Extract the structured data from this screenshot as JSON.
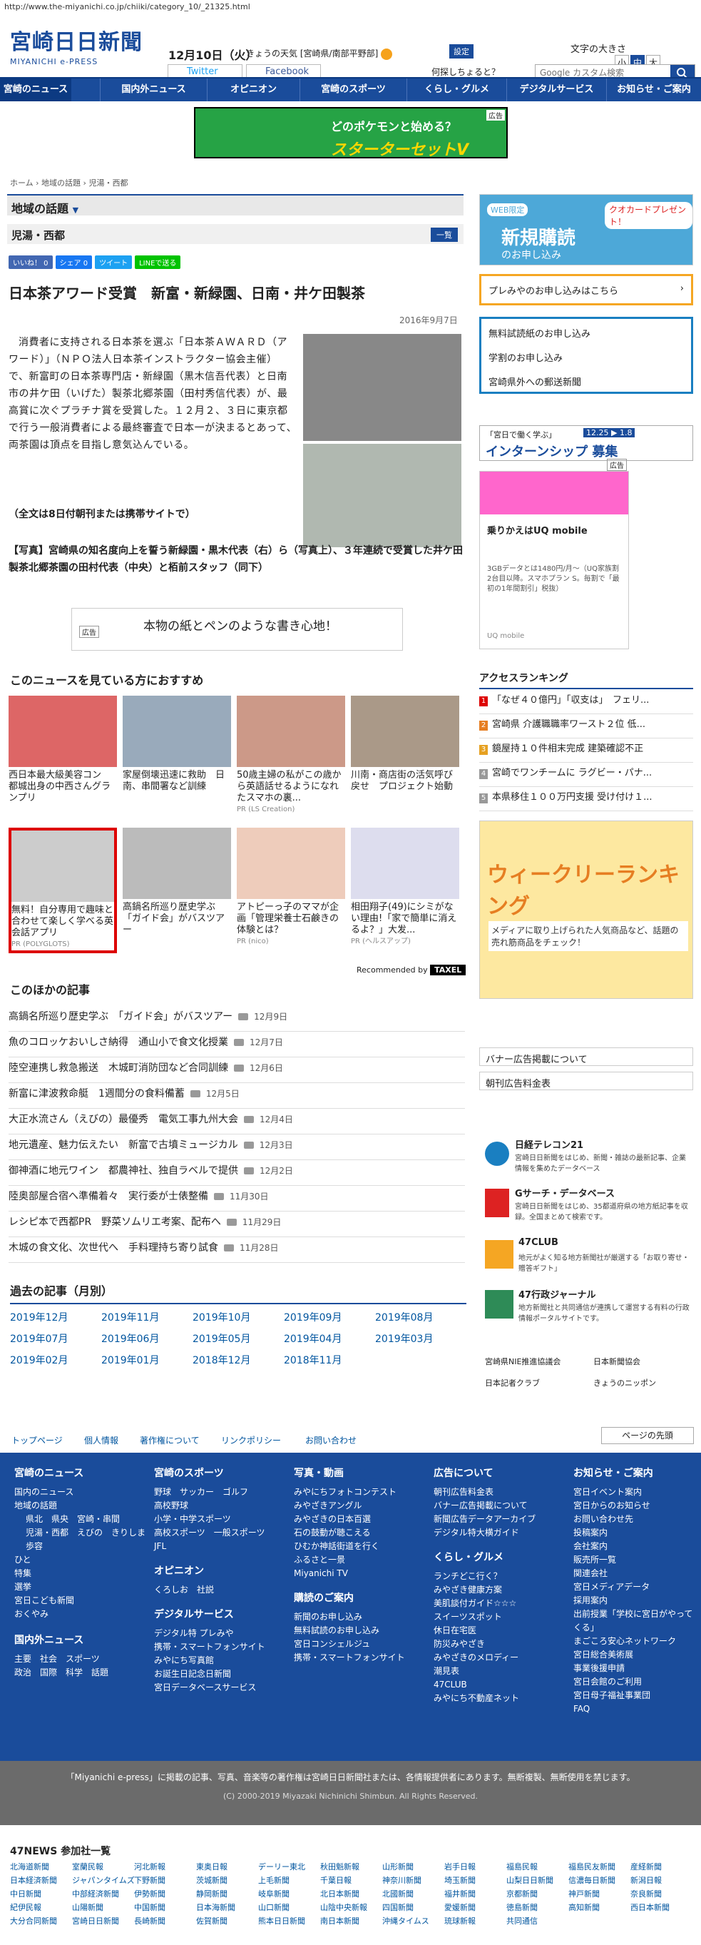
{
  "browser": {
    "url": "http://www.the-miyanichi.co.jp/chiiki/category_10/_21325.html"
  },
  "header": {
    "logo_main": "宮崎日日新聞",
    "logo_sub": "MIYANICHI e-PRESS",
    "date": "12月10日（火）",
    "weather_label": "きょうの天気",
    "region": "[宮崎県/南部平野部]",
    "settings": "設定",
    "font_size_label": "文字の大きさ",
    "font_sizes": [
      "小",
      "中",
      "大"
    ],
    "twitter": "Twitter",
    "facebook": "Facebook",
    "query": "何探しちょると？",
    "search_placeholder": "Google カスタム検索"
  },
  "nav": [
    "宮崎のニュース",
    "国内外ニュース",
    "オピニオン",
    "宮崎のスポーツ",
    "くらし・グルメ",
    "デジタルサービス",
    "お知らせ・ご案内"
  ],
  "banner": {
    "line1": "どのポケモンと始める？",
    "line2": "スターターセットV",
    "badge": "広告"
  },
  "breadcrumb": "ホーム › 地域の話題 › 児湯・西都",
  "section": {
    "title": "地域の話題",
    "sub": "児湯・西都",
    "list_btn": "一覧"
  },
  "share": {
    "like": "いいね！ 0",
    "fb_share": "シェア 0",
    "tweet": "ツイート",
    "line": "LINEで送る"
  },
  "article": {
    "title": "日本茶アワード受賞　新富・新緑園、日南・井ケ田製茶",
    "date": "2016年9月7日",
    "body": "消費者に支持される日本茶を選ぶ「日本茶ＡＷＡＲＤ（アワード）」（ＮＰＯ法人日本茶インストラクター協会主催）で、新富町の日本茶専門店・新緑園（黒木信吾代表）と日南市の井ケ田（いげた）製茶北郷茶園（田村秀信代表）が、最高賞に次ぐプラチナ賞を受賞した。１２月２、３日に東京都で行う一般消費者による最終審査で日本一が決まるとあって、両茶園は頂点を目指し意気込んでいる。",
    "full_text": "（全文は8日付朝刊または携帯サイトで）",
    "caption": "【写真】宮崎県の知名度向上を誓う新緑園・黒木代表（右）ら（写真上）、３年連続で受賞した井ケ田製茶北郷茶園の田村代表（中央）と栢前スタッフ（同下）"
  },
  "inline_ad": {
    "badge": "広告",
    "text": "本物の紙とペンのような書き心地！"
  },
  "recommend": {
    "title": "このニュースを見ている方におすすめ",
    "items": [
      {
        "text": "西日本最大級美容コン　都城出身の中西さんグランプリ",
        "pr": ""
      },
      {
        "text": "家屋倒壊迅速に救助　日南、串間署など訓練",
        "pr": ""
      },
      {
        "text": "50歳主婦の私がこの歳から英語話せるようになれたスマホの裏...",
        "pr": "PR (LS Creation)"
      },
      {
        "text": "川南・商店街の活気呼び戻せ　プロジェクト始動",
        "pr": ""
      },
      {
        "text": "無料！自分専用で趣味と合わせて楽しく学べる英会話アプリ",
        "pr": "PR (POLYGLOTS)"
      },
      {
        "text": "高鍋名所巡り歴史学ぶ　「ガイド会」がバスツアー",
        "pr": ""
      },
      {
        "text": "アトピーっ子のママが企画「管理栄養士石鹸きの体験とは？",
        "pr": "PR (nico)"
      },
      {
        "text": "相田翔子(49)にシミがない理由!「家で簡単に消えるよ？」大发...",
        "pr": "PR (ヘルスアップ)"
      }
    ],
    "recommended_by": "Recommended by",
    "taxel": "TAXEL"
  },
  "other": {
    "title": "このほかの記事",
    "items": [
      {
        "text": "高鍋名所巡り歴史学ぶ　「ガイド会」がバスツアー",
        "date": "12月9日"
      },
      {
        "text": "魚のコロッケおいしさ納得　通山小で食文化授業",
        "date": "12月7日"
      },
      {
        "text": "陸空連携し救急搬送　木城町消防団など合同訓練",
        "date": "12月6日"
      },
      {
        "text": "新富に津波救命艇　1週間分の食料備蓄",
        "date": "12月5日"
      },
      {
        "text": "大正水流さん（えびの）最優秀　電気工事九州大会",
        "date": "12月4日"
      },
      {
        "text": "地元遺産、魅力伝えたい　新富で古墳ミュージカル",
        "date": "12月3日"
      },
      {
        "text": "御神酒に地元ワイン　都農神社、独自ラベルで提供",
        "date": "12月2日"
      },
      {
        "text": "陸奥部屋合宿へ準備着々　実行委が士俵整備",
        "date": "11月30日"
      },
      {
        "text": "レシピ本で西都PR　野菜ソムリエ考案、配布へ",
        "date": "11月29日"
      },
      {
        "text": "木城の食文化、次世代へ　手料理持ち寄り試食",
        "date": "11月28日"
      }
    ]
  },
  "past": {
    "title": "過去の記事（月別）",
    "months": [
      "2019年12月",
      "2019年11月",
      "2019年10月",
      "2019年09月",
      "2019年08月",
      "2019年07月",
      "2019年06月",
      "2019年05月",
      "2019年04月",
      "2019年03月",
      "2019年02月",
      "2019年01月",
      "2018年12月",
      "2018年11月"
    ]
  },
  "sidebar": {
    "subscribe_title": "新規購読",
    "subscribe_sub": "のお申し込み",
    "web_limited": "WEB限定",
    "present": "クオカードプレゼント！",
    "premium": "プレみやのお申し込みはこちら",
    "links": [
      "無料試読紙のお申し込み",
      "学割のお申し込み",
      "宮崎県外への郵送新聞"
    ],
    "internship_lead": "「宮日で働く学ぶ」",
    "internship": "インターンシップ 募集",
    "internship_date": "12.25",
    "internship_date2": "1.8",
    "ad_badge": "広告",
    "ad_title": "乗りかえはUQ mobile",
    "ad_body": "3GBデータとは1480円/月〜（UQ家族割2台目以降。スマホプラン S。毎割で「最初の1年間割引」税抜）",
    "ad_brand": "UQ mobile",
    "ranking_title": "アクセスランキング",
    "ranking": [
      "「なぜ４０億円」「収支は」　フェリ...",
      "宮崎県 介護職職率ワースト２位 低...",
      "鏡屋持１０件相末完成 建築確認不正",
      "宮崎でワンチームに ラグビー・パナ...",
      "本県移住１００万円支援 受け付け１..."
    ],
    "weekly_title": "ウィークリーランキング",
    "weekly_sub": "メディアに取り上げられた人気商品など、話題の売れ筋商品をチェック！",
    "links2": [
      "バナー広告掲載について",
      "朝刊広告料金表"
    ],
    "services": [
      {
        "name": "日経テレコン21",
        "desc": "宮崎日日新聞をはじめ、新聞・雑誌の最新記事、企業情報を集めたデータベース"
      },
      {
        "name": "Gサーチ・データベース",
        "desc": "宮崎日日新聞をはじめ、35都道府県の地方紙記事を収録。全国まとめて検索です。"
      },
      {
        "name": "47CLUB",
        "desc": "地元がよく知る地方新聞社が厳選する「お取り寄せ・贈答ギフト」"
      },
      {
        "name": "47行政ジャーナル",
        "desc": "地方新聞社と共同通信が連携して運営する有料の行政情報ポータルサイトです。"
      }
    ],
    "bottom_links": [
      "宮崎県NIE推進協議会",
      "日本新聞協会",
      "日本記者クラブ",
      "きょうのニッポン"
    ]
  },
  "footer_top": {
    "links": [
      "トップページ",
      "個人情報",
      "著作権について",
      "リンクポリシー",
      "お問い合わせ"
    ],
    "page_top": "ページの先頭"
  },
  "footer": {
    "cols": [
      {
        "head": "宮崎のニュース",
        "links": [
          "国内のニュース",
          "地域の話題",
          "県北　県央　宮崎・串間",
          "児湯・西都　えびの　きりしま",
          "歩容",
          "ひと",
          "特集",
          "選挙",
          "宮日こども新聞",
          "おくやみ"
        ],
        "head2": "国内外ニュース",
        "links2": [
          "主要　社会　スポーツ",
          "政治　国際　科学　話題"
        ]
      },
      {
        "head": "宮崎のスポーツ",
        "links": [
          "野球　サッカー　ゴルフ",
          "高校野球",
          "小学・中学スポーツ",
          "高校スポーツ　一般スポーツ",
          "JFL"
        ],
        "head2": "オピニオン",
        "links2": [
          "くろしお　社説"
        ],
        "head3": "デジタルサービス",
        "links3": [
          "デジタル特 プレみや",
          "携帯・スマートフォンサイト",
          "みやにち写真館",
          "お誕生日記念日新聞",
          "宮日データベースサービス"
        ]
      },
      {
        "head": "写真・動画",
        "links": [
          "みやにちフォトコンテスト",
          "みやざきアングル",
          "みやざきの日本百選",
          "石の鼓動が聴こえる",
          "ひむか神話街道を行く",
          "ふるさと一景",
          "Miyanichi TV"
        ],
        "head2": "購読のご案内",
        "links2": [
          "新聞のお申し込み",
          "無料試読のお申し込み",
          "宮日コンシェルジュ",
          "携帯・スマートフォンサイト"
        ]
      },
      {
        "head": "広告について",
        "links": [
          "朝刊広告料金表",
          "バナー広告掲載について",
          "新聞広告データアーカイブ",
          "デジタル特大横ガイド"
        ],
        "head2": "くらし・グルメ",
        "links2": [
          "ランチどこ行く？",
          "みやざき健康方案",
          "美肌談付ガイド☆☆☆",
          "スイーツスポット",
          "休日在宅医",
          "防災みやざき",
          "みやざきのメロディー",
          "潮見表",
          "47CLUB",
          "みやにち不動産ネット"
        ]
      },
      {
        "head": "お知らせ・ご案内",
        "links": [
          "宮日イベント案内",
          "宮日からのお知らせ",
          "お問い合わせ先",
          "投稿案内",
          "会社案内",
          "販売所一覧",
          "関連会社",
          "宮日メディアデータ",
          "採用案内",
          "出前授業「学校に宮日がやってくる」",
          "まごころ安心ネットワーク",
          "宮日総合美術展",
          "事業後援申請",
          "宮日会館のご利用",
          "宮日母子福祉事業団",
          "FAQ"
        ]
      }
    ]
  },
  "copyright": {
    "line1": "「Miyanichi e-press」に掲載の記事、写真、音楽等の著作権は宮崎日日新聞社または、各情報提供者にあります。無断複製、無断使用を禁じます。",
    "line2": "(C) 2000-2019 Miyazaki Nichinichi Shimbun. All Rights Reserved."
  },
  "news47": {
    "title": "47NEWS 参加社一覧",
    "items": [
      "北海道新聞",
      "室蘭民報",
      "河北新報",
      "東奥日報",
      "デーリー東北",
      "秋田魁新報",
      "山形新聞",
      "岩手日報",
      "福島民報",
      "福島民友新聞",
      "産経新聞",
      "日本経済新聞",
      "ジャパンタイムズ",
      "下野新聞",
      "茨城新聞",
      "上毛新聞",
      "千葉日報",
      "神奈川新聞",
      "埼玉新聞",
      "山梨日日新聞",
      "信濃毎日新聞",
      "新潟日報",
      "中日新聞",
      "中部経済新聞",
      "伊勢新聞",
      "静岡新聞",
      "岐阜新聞",
      "北日本新聞",
      "北國新聞",
      "福井新聞",
      "京都新聞",
      "神戸新聞",
      "奈良新聞",
      "紀伊民報",
      "山陽新聞",
      "中国新聞",
      "日本海新聞",
      "山口新聞",
      "山陰中央新報",
      "四国新聞",
      "愛媛新聞",
      "徳島新聞",
      "高知新聞",
      "西日本新聞",
      "大分合同新聞",
      "宮崎日日新聞",
      "長崎新聞",
      "佐賀新聞",
      "熊本日日新聞",
      "南日本新聞",
      "沖縄タイムス",
      "琉球新報",
      "共同通信"
    ]
  }
}
